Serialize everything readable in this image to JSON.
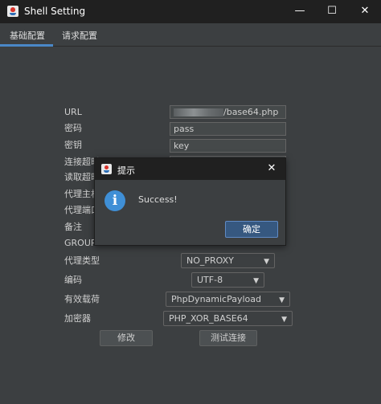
{
  "window": {
    "title": "Shell Setting",
    "min_glyph": "—",
    "max_glyph": "☐",
    "close_glyph": "✕"
  },
  "tabs": [
    {
      "label": "基础配置",
      "selected": true
    },
    {
      "label": "请求配置",
      "selected": false
    }
  ],
  "form": {
    "labels": {
      "url": "URL",
      "password": "密码",
      "key": "密钥",
      "connect_timeout": "连接超时",
      "read_timeout": "读取超时",
      "proxy_host": "代理主机",
      "proxy_port": "代理端口",
      "note": "备注",
      "group": "GROUP",
      "proxy_type": "代理类型",
      "encoding": "编码",
      "payload": "有效载荷",
      "crypto": "加密器"
    },
    "url_value": "/base64.php",
    "password_value": "pass",
    "key_value": "key",
    "proxy_type_value": "NO_PROXY",
    "encoding_value": "UTF-8",
    "payload_value": "PhpDynamicPayload",
    "crypto_value": "PHP_XOR_BASE64",
    "modify_button": "修改",
    "test_button": "测试连接"
  },
  "dialog": {
    "title": "提示",
    "close_glyph": "✕",
    "info_glyph": "i",
    "message": "Success!",
    "ok_button": "确定"
  },
  "icons": {
    "app": "java-icon",
    "info": "info-icon",
    "dropdown": "chevron-down-icon"
  },
  "colors": {
    "background": "#3c3f41",
    "titlebar": "#202020",
    "accent": "#4a88c7",
    "ok_button": "#365880",
    "info_icon": "#3f8fd6"
  }
}
